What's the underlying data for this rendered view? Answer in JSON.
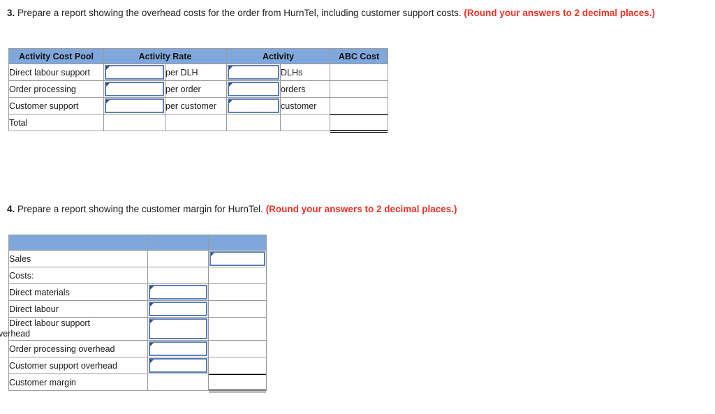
{
  "questions": [
    {
      "number": "3.",
      "text": " Prepare a report showing the overhead costs for the order from HurnTel, including customer support costs. ",
      "hint": "(Round your answers to 2 decimal places.)"
    },
    {
      "number": "4.",
      "text": " Prepare a report showing the customer margin for HurnTel. ",
      "hint": "(Round your answers to 2 decimal places.)"
    }
  ],
  "colors": {
    "header_blue": "#7fa7dc",
    "entry_border": "#5b7fb5",
    "entry_marker": "#2f4f82",
    "hint_red": "#ee3124",
    "grid_line": "#9a9a9a"
  },
  "overhead_table": {
    "headers": {
      "activity_cost_pool": "Activity Cost Pool",
      "activity_rate": "Activity Rate",
      "activity": "Activity",
      "abc_cost": "ABC Cost"
    },
    "rows": [
      {
        "pool": "Direct labour support",
        "rate_value": "",
        "rate_unit": "per DLH",
        "activity_value": "",
        "activity_unit": "DLHs",
        "abc_cost": ""
      },
      {
        "pool": "Order processing",
        "rate_value": "",
        "rate_unit": "per order",
        "activity_value": "",
        "activity_unit": "orders",
        "abc_cost": ""
      },
      {
        "pool": "Customer support",
        "rate_value": "",
        "rate_unit": "per customer",
        "activity_value": "",
        "activity_unit": "customer",
        "abc_cost": ""
      }
    ],
    "total_row": {
      "label": "Total",
      "rate_value": "",
      "rate_unit": "",
      "activity_value": "",
      "activity_unit": "",
      "abc_cost": ""
    }
  },
  "customer_margin_table": {
    "headers": {
      "col1": "",
      "col2": "",
      "col3": ""
    },
    "rows": [
      {
        "label": "Sales",
        "mid": "",
        "amount": ""
      },
      {
        "label": "Costs:",
        "mid": "",
        "amount": ""
      },
      {
        "label": "Direct materials",
        "mid": "",
        "amount": ""
      },
      {
        "label": "Direct labour",
        "mid": "",
        "amount": ""
      },
      {
        "label_line1": "Direct labour support",
        "label_line2": "overhead",
        "mid": "",
        "amount": ""
      },
      {
        "label": "Order processing overhead",
        "mid": "",
        "amount": ""
      },
      {
        "label": "Customer support overhead",
        "mid": "",
        "amount": ""
      },
      {
        "label": "Customer margin",
        "mid": "",
        "amount": ""
      }
    ]
  }
}
